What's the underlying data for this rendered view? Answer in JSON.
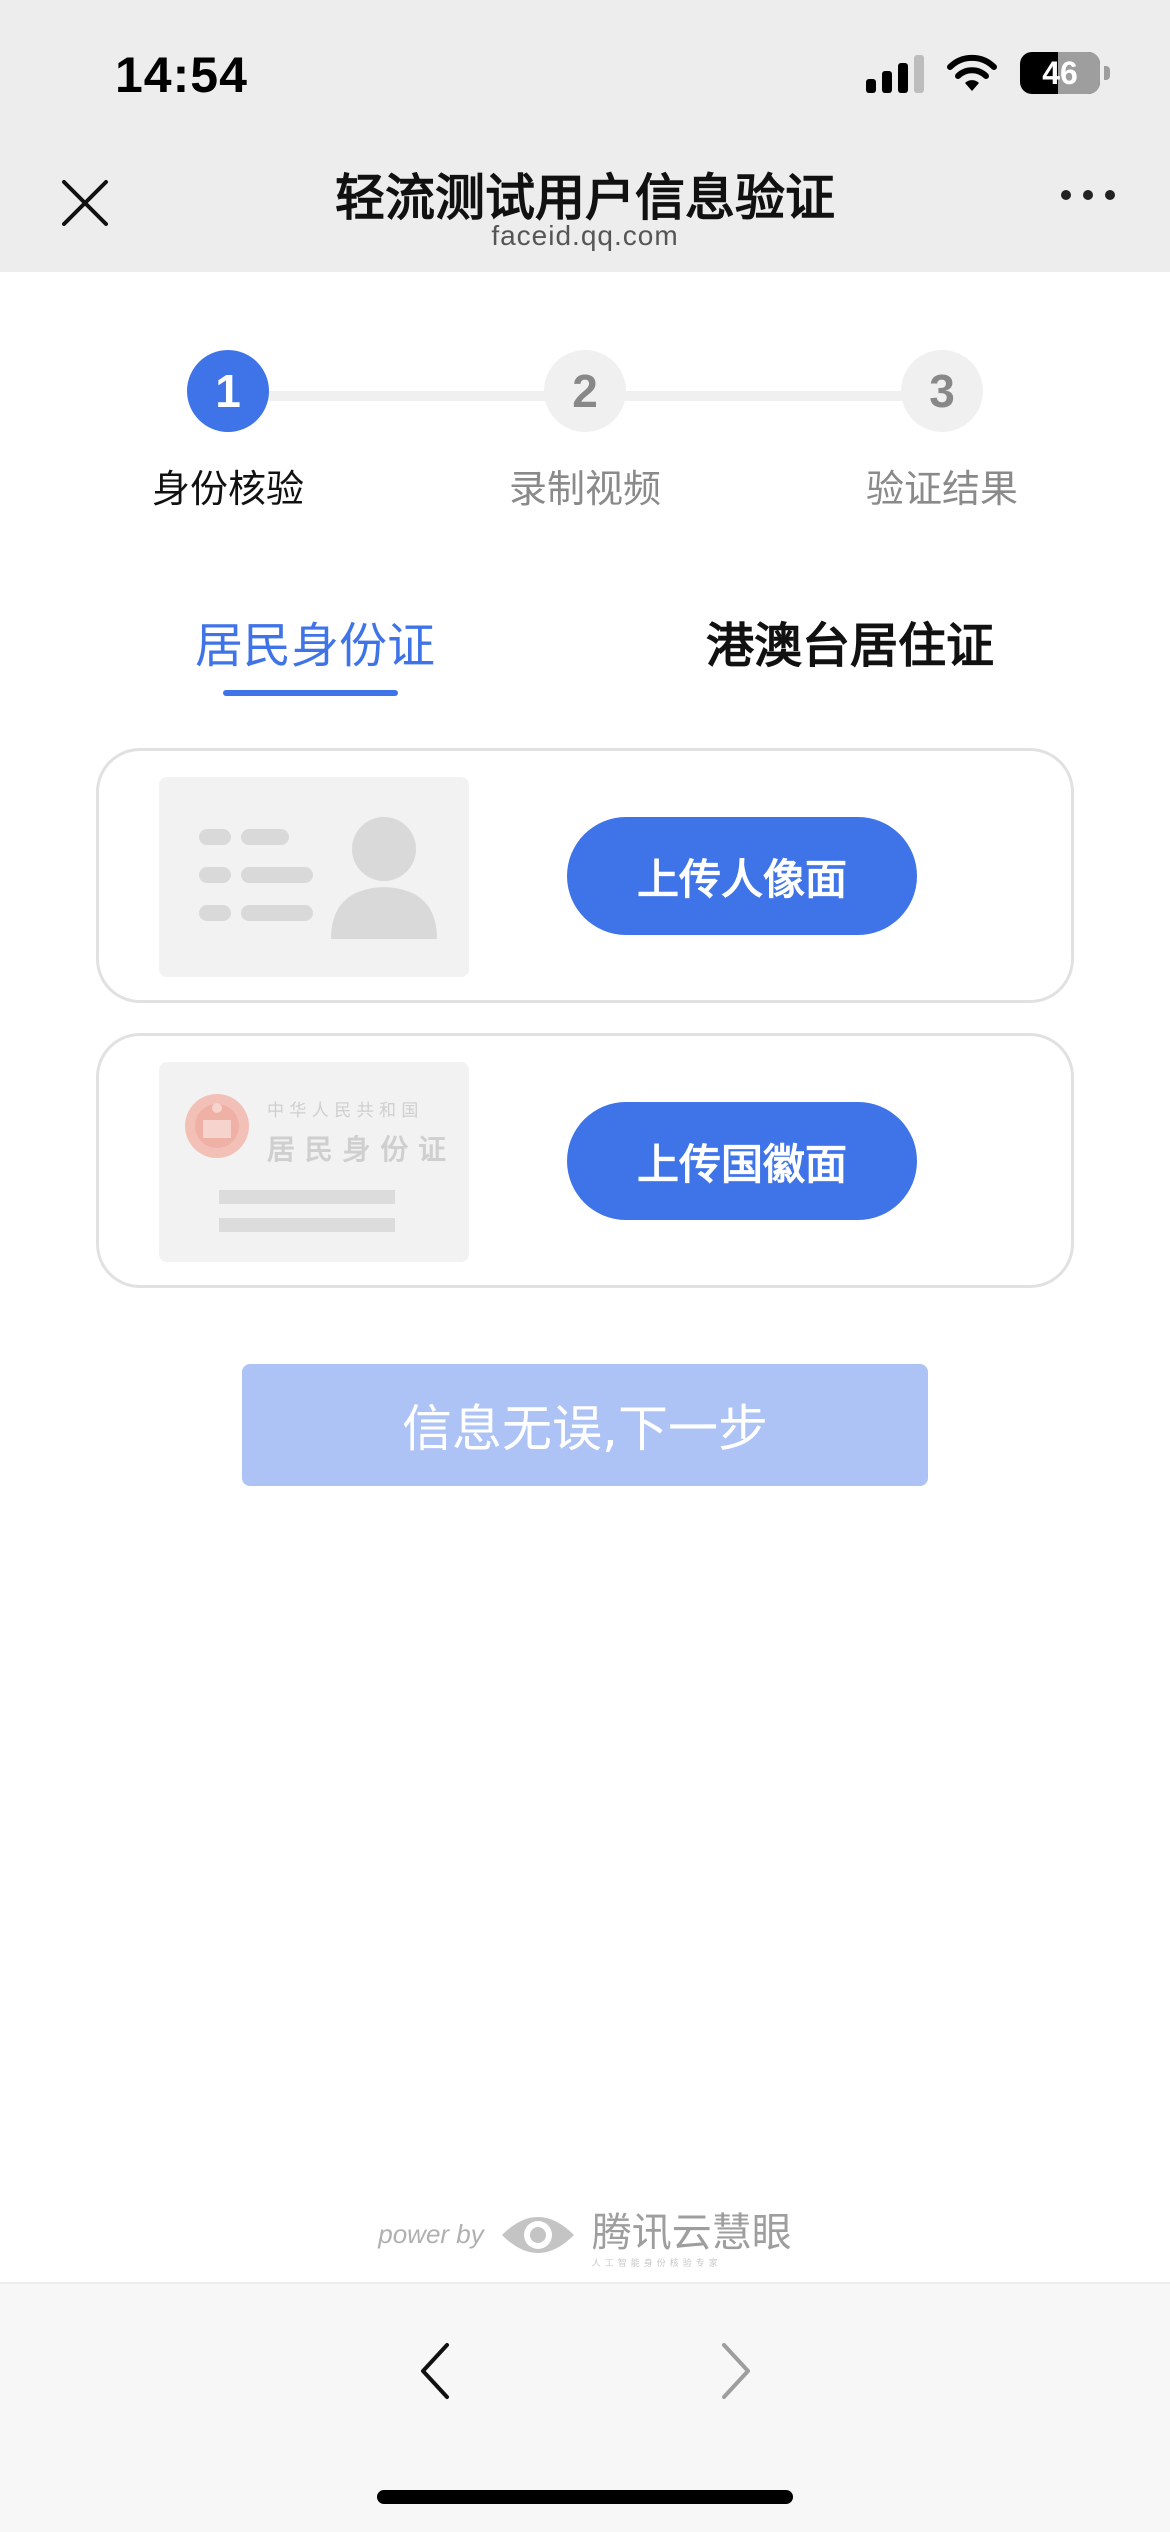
{
  "status_bar": {
    "time": "14:54",
    "battery": "46",
    "icons": [
      "signal-icon",
      "wifi-icon",
      "battery-icon"
    ]
  },
  "header": {
    "title": "轻流测试用户信息验证",
    "subtitle": "faceid.qq.com",
    "close_icon": "close-icon",
    "more_icon": "more-icon"
  },
  "stepper": {
    "steps": [
      {
        "number": "1",
        "label": "身份核验",
        "state": "active"
      },
      {
        "number": "2",
        "label": "录制视频",
        "state": "inactive"
      },
      {
        "number": "3",
        "label": "验证结果",
        "state": "inactive"
      }
    ]
  },
  "tabs": [
    {
      "label": "居民身份证",
      "active": true
    },
    {
      "label": "港澳台居住证",
      "active": false
    }
  ],
  "cards": [
    {
      "button": "上传人像面",
      "illustration": "id-portrait-illustration"
    },
    {
      "button": "上传国徽面",
      "illustration": "id-emblem-illustration",
      "emblem_line1": "中 华 人 民 共 和 国",
      "emblem_line2": "居 民 身 份 证"
    }
  ],
  "next_button": "信息无误,下一步",
  "footer": {
    "powered_by": "power by",
    "brand": "腾讯云慧眼",
    "brand_tagline": "人工智能身份核验专家"
  },
  "colors": {
    "accent": "#3f73e8",
    "disabled_button": "#aec3f5",
    "header_bg": "#ededed"
  }
}
